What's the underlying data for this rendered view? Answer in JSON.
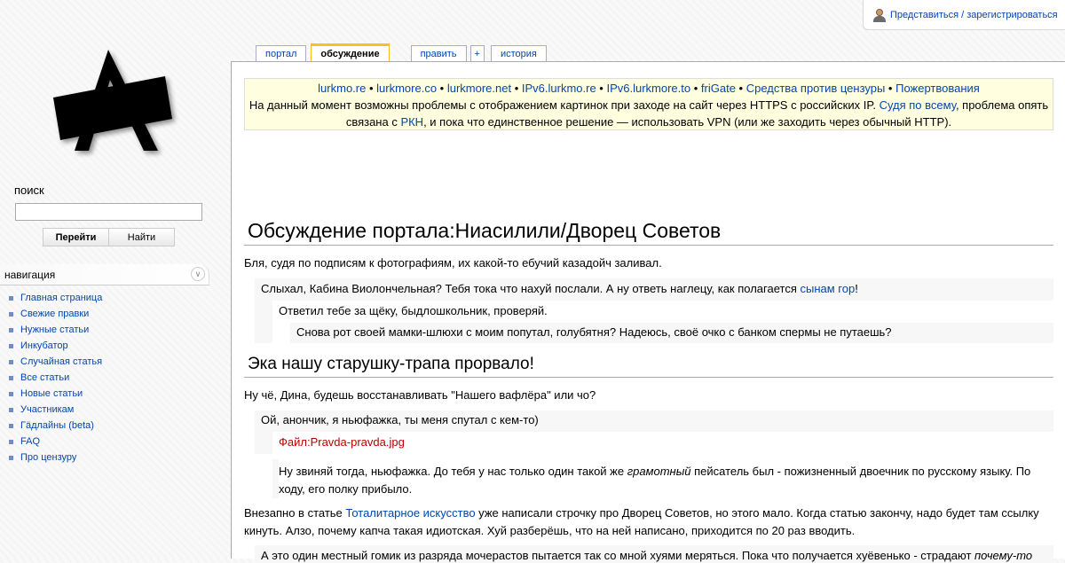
{
  "personal_tools": {
    "login_label": "Представиться / зарегистрироваться"
  },
  "search": {
    "label": "поиск",
    "value": "",
    "go_label": "Перейти",
    "find_label": "Найти"
  },
  "navigation": {
    "header": "навигация",
    "items": [
      {
        "label": "Главная страница"
      },
      {
        "label": "Свежие правки"
      },
      {
        "label": "Нужные статьи"
      },
      {
        "label": "Инкубатор"
      },
      {
        "label": "Случайная статья"
      },
      {
        "label": "Все статьи"
      },
      {
        "label": "Новые статьи"
      },
      {
        "label": "Участникам"
      },
      {
        "label": "Гäдлайны (beta)"
      },
      {
        "label": "FAQ"
      },
      {
        "label": "Про цензуру"
      }
    ]
  },
  "tabs": {
    "portal": "портал",
    "discussion": "обсуждение",
    "edit": "править",
    "plus": "+",
    "history": "история"
  },
  "sitenotice": {
    "links": [
      "lurkmo.re",
      "lurkmore.co",
      "lurkmore.net",
      "IPv6.lurkmo.re",
      "IPv6.lurkmore.to",
      "friGate",
      "Средства против цензуры",
      "Пожертвования"
    ],
    "sep": " • ",
    "line2_a": "На данный момент возможны проблемы с отображением картинок при заходе на сайт через HTTPS с российских IP. ",
    "line2_link": "Судя по всему",
    "line2_b": ", проблема опять",
    "line3_a": "связана с ",
    "line3_link": "РКН",
    "line3_b": ", и пока что единственное решение — использовать VPN (или же заходить через обычный HTTP)."
  },
  "page": {
    "title": "Обсуждение портала:Ниасилили/Дворец Советов",
    "p1": "Бля, судя по подписям к фотографиям, их какой-то ебучий казадойч заливал.",
    "r1_a": "Слыхал, Кабина Виолончельная? Тебя тока что нахуй послали. А ну ответь наглецу, как полагается ",
    "r1_link": "сынам гор",
    "r1_b": "!",
    "r2": "Ответил тебе за щёку, быдлошкольник, проверяй.",
    "r3": "Снова рот своей мамки-шлюхи с моим попутал, голубятня? Надеюсь, своё очко с банком спермы не путаешь?",
    "h2": "Эка нашу старушку-трапа прорвало!",
    "p2": "Ну чё, Дина, будешь восстанавливать \"Нашего вафлёра\" или чо?",
    "r4": "Ой, анончик, я ньюфажка, ты меня спутал с кем-то)",
    "r5_link": "Файл:Pravda-pravda.jpg",
    "r6_a": "Ну звиняй тогда, ньюфажка. До тебя у нас только один такой же ",
    "r6_em": "грамотный",
    "r6_b": " пейсатель был - пожизненный двоечник по русскому языку. По",
    "r6_c": "ходу, его полку прибыло.",
    "p3_a": "Внезапно в статье ",
    "p3_link": "Тоталитарное искусство",
    "p3_b": " уже написали строчку про Дворец Советов, но этого мало. Когда статью закончу, надо будет там ссылку",
    "p3_c": "кинуть. Алзо, почему капча такая идиотская. Хуй разберёшь, что на ней написано, приходится по 20 раз вводить.",
    "r7_a": "А это один местный гомик из разряда мочерастов пытается так со мной хуями меряться. Пока что получается хуёвенько - страдают ",
    "r7_em": "почему-то"
  }
}
